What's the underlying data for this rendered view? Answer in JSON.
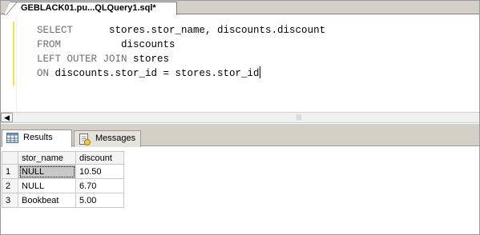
{
  "document_tab": {
    "title": "GEBLACK01.pu...QLQuery1.sql*"
  },
  "editor": {
    "lines": [
      {
        "keyword": "SELECT",
        "rest": "      stores.stor_name, discounts.discount"
      },
      {
        "keyword": "FROM",
        "rest": "          discounts"
      },
      {
        "keyword": "LEFT OUTER JOIN",
        "rest": " stores"
      },
      {
        "keyword": "ON",
        "rest": " discounts.stor_id = stores.stor_id"
      }
    ]
  },
  "results_tabs": {
    "results_label": "Results",
    "messages_label": "Messages"
  },
  "grid": {
    "columns": [
      "stor_name",
      "discount"
    ],
    "rows": [
      {
        "num": "1",
        "stor_name": "NULL",
        "discount": "10.50"
      },
      {
        "num": "2",
        "stor_name": "NULL",
        "discount": "6.70"
      },
      {
        "num": "3",
        "stor_name": "Bookbeat",
        "discount": "5.00"
      }
    ]
  },
  "colors": {
    "keyword": "#6f6f6f",
    "change_bar": "#f2e24d",
    "chrome": "#d4d0c8"
  }
}
